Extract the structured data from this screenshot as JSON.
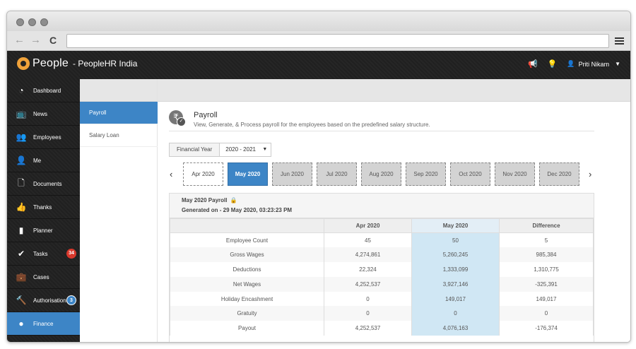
{
  "app": {
    "brand": "People",
    "org": "- PeopleHR India",
    "user": "Priti Nikam"
  },
  "sidebar": {
    "items": [
      {
        "label": "Dashboard",
        "icon": "dashboard-icon"
      },
      {
        "label": "News",
        "icon": "tv-icon"
      },
      {
        "label": "Employees",
        "icon": "people-icon"
      },
      {
        "label": "Me",
        "icon": "user-edit-icon"
      },
      {
        "label": "Documents",
        "icon": "document-icon"
      },
      {
        "label": "Thanks",
        "icon": "thumbs-up-icon"
      },
      {
        "label": "Planner",
        "icon": "planner-icon"
      },
      {
        "label": "Tasks",
        "icon": "check-icon",
        "badge": "34"
      },
      {
        "label": "Cases",
        "icon": "briefcase-icon"
      },
      {
        "label": "Authorisations",
        "icon": "gavel-icon",
        "badge": "3"
      },
      {
        "label": "Finance",
        "icon": "coins-icon",
        "active": true
      }
    ]
  },
  "subnav": {
    "items": [
      "Payroll",
      "Salary Loan"
    ]
  },
  "page": {
    "title": "Payroll",
    "description": "View, Generate, & Process payroll for the employees based on the predefined salary structure.",
    "fy_label": "Financial Year",
    "fy_value": "2020 - 2021"
  },
  "months": [
    "Apr 2020",
    "May 2020",
    "Jun 2020",
    "Jul 2020",
    "Aug 2020",
    "Sep 2020",
    "Oct 2020",
    "Nov 2020",
    "Dec 2020"
  ],
  "selected_month": "May 2020",
  "panel": {
    "title": "May 2020 Payroll",
    "generated": "Generated on - 29 May 2020, 03:23:23 PM"
  },
  "table": {
    "headers": [
      "",
      "Apr 2020",
      "May 2020",
      "Difference"
    ],
    "rows": [
      [
        "Employee Count",
        "45",
        "50",
        "5"
      ],
      [
        "Gross Wages",
        "4,274,861",
        "5,260,245",
        "985,384"
      ],
      [
        "Deductions",
        "22,324",
        "1,333,099",
        "1,310,775"
      ],
      [
        "Net Wages",
        "4,252,537",
        "3,927,146",
        "-325,391"
      ],
      [
        "Holiday Encashment",
        "0",
        "149,017",
        "149,017"
      ],
      [
        "Gratuity",
        "0",
        "0",
        "0"
      ],
      [
        "Payout",
        "4,252,537",
        "4,076,163",
        "-176,374"
      ]
    ]
  },
  "colors": {
    "accent": "#3d85c6",
    "topbar": "#232323",
    "badge_red": "#d9382c",
    "highlight": "#d0e7f4"
  }
}
